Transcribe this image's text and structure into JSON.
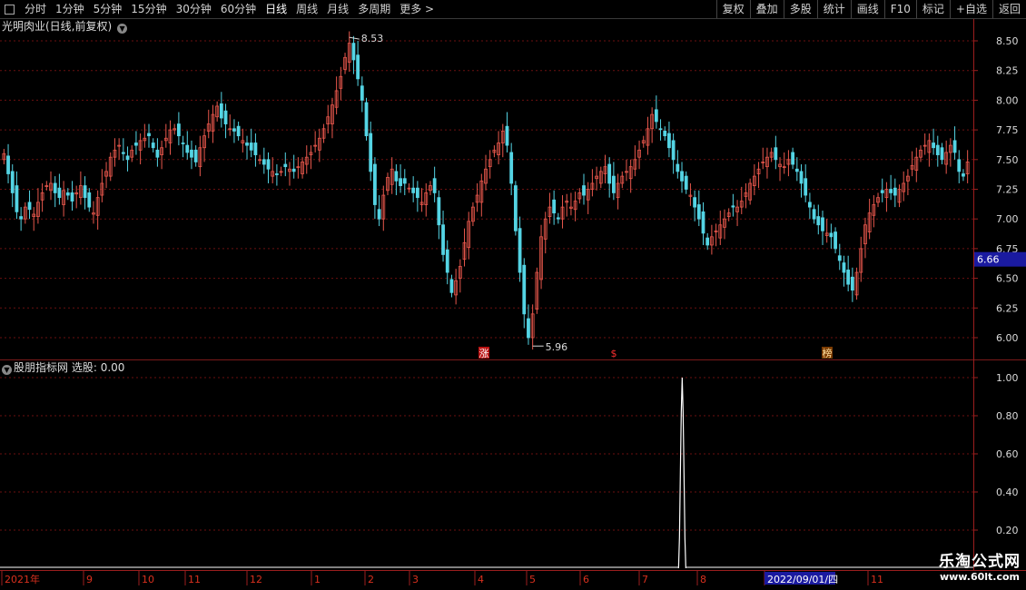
{
  "toolbar": {
    "left_items": [
      "分时",
      "1分钟",
      "5分钟",
      "15分钟",
      "30分钟",
      "60分钟",
      "日线",
      "周线",
      "月线",
      "多周期",
      "更多 >"
    ],
    "active_item": "日线",
    "right_items": [
      "复权",
      "叠加",
      "多股",
      "统计",
      "画线",
      "F10",
      "标记",
      "+自选",
      "返回"
    ]
  },
  "stock_title": "光明肉业(日线,前复权)",
  "indicator": {
    "title": "股朋指标网",
    "label": "选股:",
    "value": "0.00"
  },
  "price_axis": [
    "8.50",
    "8.25",
    "8.00",
    "7.75",
    "7.50",
    "7.25",
    "7.00",
    "6.75",
    "6.50",
    "6.25",
    "6.00"
  ],
  "indicator_axis": [
    "1.00",
    "0.80",
    "0.60",
    "0.40",
    "0.20"
  ],
  "current_price": "6.66",
  "high_label": "8.53",
  "low_label": "5.96",
  "markers": [
    "涨",
    "$",
    "榜"
  ],
  "date_axis": [
    "2021年",
    "9",
    "10",
    "11",
    "12",
    "1",
    "2",
    "3",
    "4",
    "5",
    "6",
    "7",
    "8",
    "2022/09/01/四",
    "11"
  ],
  "watermark": {
    "line1": "乐淘公式网",
    "line2": "www.60lt.com"
  },
  "colors": {
    "up": "#e8574c",
    "down": "#54d4e4",
    "grid": "#6b1010",
    "axis": "#9b1e1e",
    "price_tag_bg": "#1a1aa0"
  },
  "chart_data": {
    "type": "candlestick",
    "ylim": [
      5.9,
      8.6
    ],
    "close": [
      7.55,
      7.38,
      7.22,
      7.06,
      7.0,
      7.1,
      7.08,
      7.04,
      7.14,
      7.22,
      7.28,
      7.3,
      7.22,
      7.18,
      7.24,
      7.2,
      7.15,
      7.22,
      7.28,
      7.18,
      7.1,
      7.05,
      7.18,
      7.3,
      7.4,
      7.52,
      7.58,
      7.62,
      7.55,
      7.5,
      7.58,
      7.62,
      7.66,
      7.68,
      7.7,
      7.6,
      7.52,
      7.6,
      7.68,
      7.75,
      7.76,
      7.7,
      7.64,
      7.56,
      7.52,
      7.48,
      7.6,
      7.7,
      7.8,
      7.88,
      7.95,
      7.85,
      7.8,
      7.76,
      7.74,
      7.7,
      7.66,
      7.62,
      7.58,
      7.54,
      7.5,
      7.46,
      7.42,
      7.4,
      7.38,
      7.4,
      7.44,
      7.42,
      7.4,
      7.44,
      7.48,
      7.52,
      7.56,
      7.62,
      7.68,
      7.76,
      7.86,
      7.96,
      8.08,
      8.2,
      8.36,
      8.48,
      8.34,
      8.18,
      8.0,
      7.7,
      7.4,
      7.12,
      7.0,
      7.2,
      7.35,
      7.42,
      7.32,
      7.28,
      7.3,
      7.26,
      7.22,
      7.18,
      7.14,
      7.22,
      7.28,
      7.22,
      6.95,
      6.7,
      6.55,
      6.38,
      6.48,
      6.6,
      6.8,
      6.98,
      7.1,
      7.2,
      7.32,
      7.42,
      7.5,
      7.58,
      7.64,
      7.74,
      7.62,
      7.3,
      6.9,
      6.55,
      6.2,
      6.0,
      6.2,
      6.55,
      6.85,
      7.0,
      7.1,
      7.05,
      7.0,
      7.1,
      7.15,
      7.1,
      7.15,
      7.22,
      7.2,
      7.25,
      7.3,
      7.36,
      7.4,
      7.44,
      7.3,
      7.22,
      7.3,
      7.36,
      7.4,
      7.44,
      7.5,
      7.58,
      7.66,
      7.76,
      7.88,
      7.82,
      7.76,
      7.7,
      7.6,
      7.5,
      7.4,
      7.32,
      7.25,
      7.2,
      7.1,
      7.0,
      6.88,
      6.78,
      6.85,
      6.9,
      6.95,
      7.0,
      7.05,
      7.1,
      7.1,
      7.15,
      7.22,
      7.3,
      7.36,
      7.42,
      7.48,
      7.52,
      7.56,
      7.5,
      7.46,
      7.44,
      7.5,
      7.46,
      7.4,
      7.3,
      7.2,
      7.1,
      7.0,
      6.95,
      6.9,
      6.88,
      6.85,
      6.75,
      6.65,
      6.55,
      6.45,
      6.4,
      6.55,
      6.75,
      6.95,
      7.05,
      7.12,
      7.18,
      7.22,
      7.25,
      7.22,
      7.2,
      7.25,
      7.3,
      7.36,
      7.45,
      7.52,
      7.58,
      7.62,
      7.66,
      7.6,
      7.54,
      7.5,
      7.56,
      7.62,
      7.56,
      7.4,
      7.36,
      7.48
    ],
    "selection_signal_index": 79,
    "selection_signal_value": 1.0
  }
}
